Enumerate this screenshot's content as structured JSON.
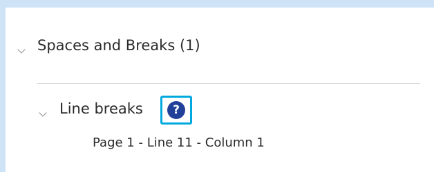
{
  "section": {
    "title": "Spaces and Breaks (1)",
    "expanded": true
  },
  "group": {
    "title": "Line breaks",
    "expanded": true,
    "help_icon_glyph": "?"
  },
  "items": [
    {
      "label": "Page 1 - Line 11 - Column 1"
    }
  ],
  "colors": {
    "accent_highlight": "#00a8e0",
    "help_icon_fill": "#21409a",
    "background": "#cfe3f7"
  }
}
